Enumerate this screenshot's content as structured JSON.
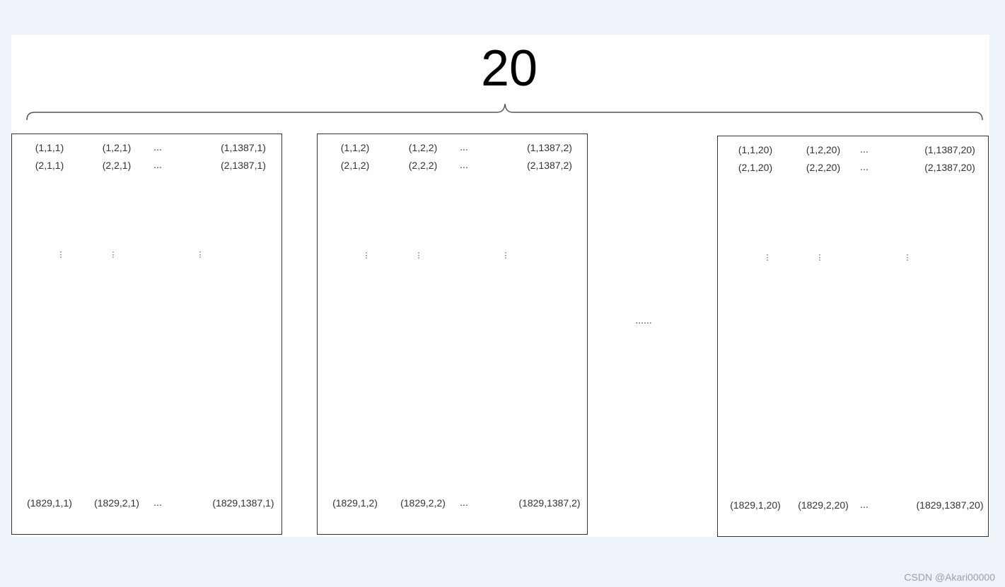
{
  "diagram": {
    "count_label": "20",
    "between_ellipsis": "......",
    "vertical_ellipsis": "⋮",
    "matrices": [
      {
        "row1": [
          "(1,1,1)",
          "(1,2,1)",
          "...",
          "(1,1387,1)"
        ],
        "row2": [
          "(2,1,1)",
          "(2,2,1)",
          "...",
          "(2,1387,1)"
        ],
        "last": [
          "(1829,1,1)",
          "(1829,2,1)",
          "...",
          "(1829,1387,1)"
        ]
      },
      {
        "row1": [
          "(1,1,2)",
          "(1,2,2)",
          "...",
          "(1,1387,2)"
        ],
        "row2": [
          "(2,1,2)",
          "(2,2,2)",
          "...",
          "(2,1387,2)"
        ],
        "last": [
          "(1829,1,2)",
          "(1829,2,2)",
          "...",
          "(1829,1387,2)"
        ]
      },
      {
        "row1": [
          "(1,1,20)",
          "(1,2,20)",
          "...",
          "(1,1387,20)"
        ],
        "row2": [
          "(2,1,20)",
          "(2,2,20)",
          "...",
          "(2,1387,20)"
        ],
        "last": [
          "(1829,1,20)",
          "(1829,2,20)",
          "...",
          "(1829,1387,20)"
        ]
      }
    ]
  },
  "watermark": "CSDN @Akari00000"
}
